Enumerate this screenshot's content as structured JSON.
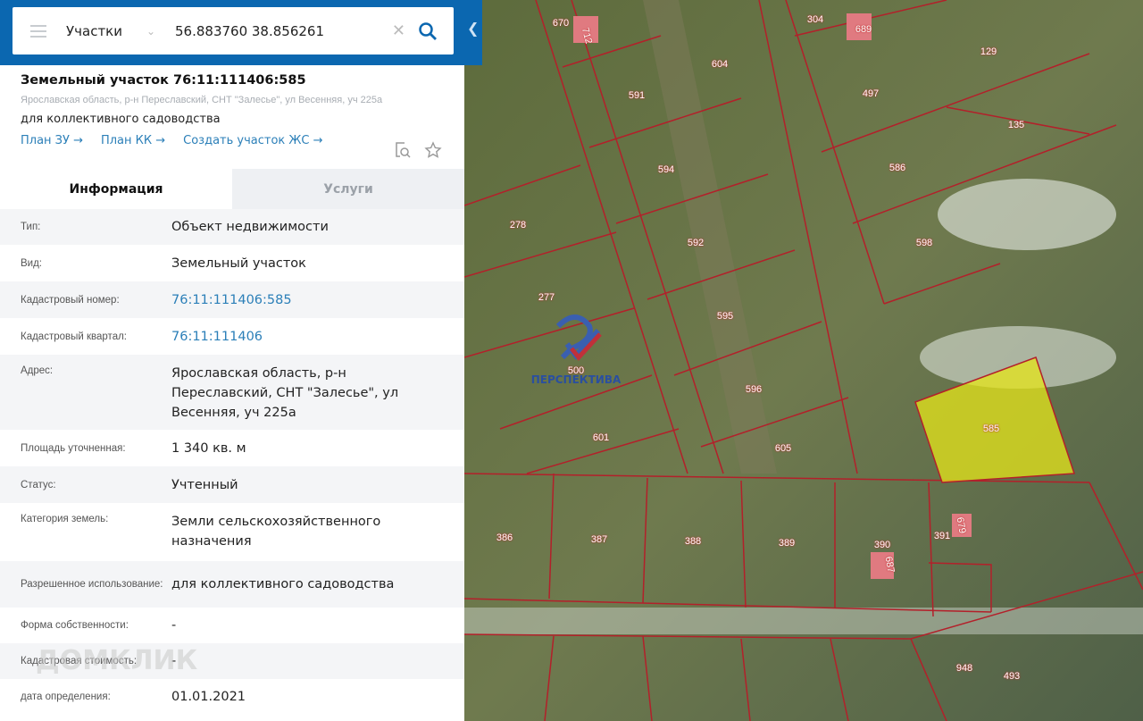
{
  "search": {
    "layer": "Участки",
    "query": "56.883760 38.856261"
  },
  "object": {
    "title": "Земельный участок 76:11:111406:585",
    "address": "Ярославская область, р-н Переславский, СНТ \"Залесье\", ул Весенняя, уч 225а",
    "use": "для коллективного садоводства",
    "links": [
      "План ЗУ →",
      "План КК →",
      "Создать участок ЖС →"
    ]
  },
  "tabs": [
    "Информация",
    "Услуги"
  ],
  "rows": [
    {
      "label": "Тип:",
      "value": "Объект недвижимости"
    },
    {
      "label": "Вид:",
      "value": "Земельный участок"
    },
    {
      "label": "Кадастровый номер:",
      "value": "76:11:111406:585"
    },
    {
      "label": "Кадастровый квартал:",
      "value": "76:11:111406"
    },
    {
      "label": "Адрес:",
      "value": "Ярославская область, р-н Переславский, СНТ \"Залесье\", ул Весенняя, уч 225а"
    },
    {
      "label": "Площадь уточненная:",
      "value": "1 340 кв. м"
    },
    {
      "label": "Статус:",
      "value": "Учтенный"
    },
    {
      "label": "Категория земель:",
      "value": "Земли сельскохозяйственного назначения"
    },
    {
      "label": "Разрешенное использование:",
      "value": "для коллективного садоводства"
    },
    {
      "label": "Форма собственности:",
      "value": "-"
    },
    {
      "label": "Кадастровая стоимость:",
      "value": "-"
    },
    {
      "label": "дата определения:",
      "value": "01.01.2021"
    }
  ],
  "watermark": "ДОМКЛИК",
  "map_logo": "ПЕРСПЕКТИВА",
  "parcels": [
    "670",
    "712",
    "304",
    "689",
    "604",
    "591",
    "497",
    "129",
    "135",
    "594",
    "586",
    "278",
    "592",
    "598",
    "277",
    "595",
    "500",
    "596",
    "601",
    "605",
    "585",
    "386",
    "387",
    "388",
    "389",
    "390",
    "687",
    "391",
    "679",
    "948",
    "493"
  ],
  "colors": {
    "accent": "#0b67b0",
    "link": "#2b7fb8",
    "selected_parcel": "#e6e619",
    "boundary": "#b3202a"
  }
}
